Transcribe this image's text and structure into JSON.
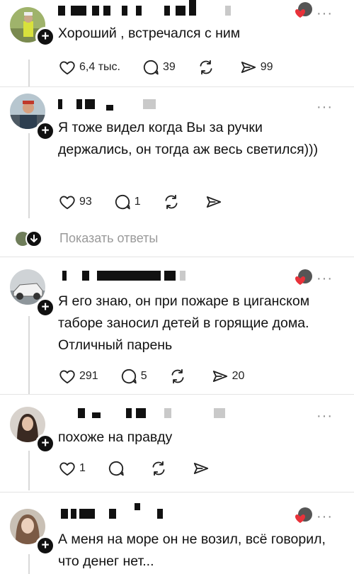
{
  "comments": [
    {
      "text": "Хороший , встречался с ним",
      "likes": "6,4 тыс.",
      "replies": "39",
      "shares": "99"
    },
    {
      "text": "Я тоже видел когда Вы за ручки держались, он тогда аж весь светился)))",
      "likes": "93",
      "replies": "1",
      "shares": ""
    },
    {
      "text": "Я его знаю, он при пожаре в циганском таборе заносил детей в горящие дома. Отличный парень",
      "likes": "291",
      "replies": "5",
      "shares": "20"
    },
    {
      "text": "похоже на правду",
      "likes": "1",
      "replies": "",
      "shares": ""
    },
    {
      "text": "А меня на море он не возил, всё говорил, что денег нет...",
      "likes": "",
      "replies": "",
      "shares": ""
    }
  ],
  "show_replies_label": "Показать ответы",
  "more_glyph": "···",
  "plus_glyph": "+",
  "colors": {
    "heart": "#e8323a",
    "icon": "#222222",
    "muted": "#9a9a9a"
  },
  "icons": [
    "heart-icon",
    "comment-icon",
    "repost-icon",
    "share-icon",
    "more-icon",
    "follow-plus-icon",
    "chevron-down-icon"
  ]
}
